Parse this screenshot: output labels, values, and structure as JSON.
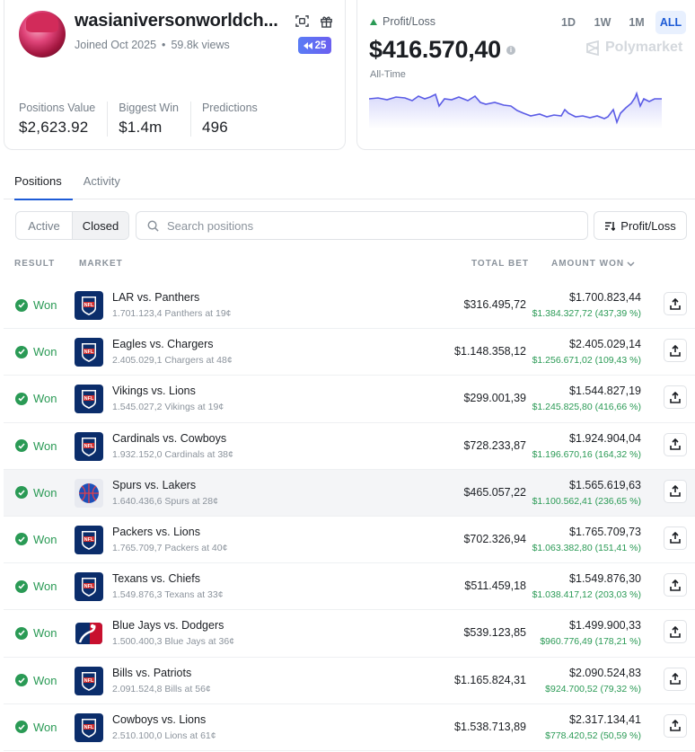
{
  "profile": {
    "username": "wasianiversonworldch...",
    "joined": "Joined Oct 2025",
    "views": "59.8k views",
    "level_badge": "25",
    "stats": [
      {
        "label": "Positions Value",
        "value": "$2,623.92"
      },
      {
        "label": "Biggest Win",
        "value": "$1.4m"
      },
      {
        "label": "Predictions",
        "value": "496"
      }
    ]
  },
  "pnl": {
    "label": "Profit/Loss",
    "value": "$416.570,40",
    "period_label": "All-Time",
    "ranges": [
      "1D",
      "1W",
      "1M",
      "ALL"
    ],
    "active_range": "ALL",
    "watermark": "Polymarket",
    "line_color": "#5b5ce6"
  },
  "tabs": [
    {
      "label": "Positions",
      "active": true
    },
    {
      "label": "Activity",
      "active": false
    }
  ],
  "filters": {
    "segment": [
      "Active",
      "Closed"
    ],
    "active_segment": "Closed",
    "search_placeholder": "Search positions",
    "sort_label": "Profit/Loss"
  },
  "table": {
    "headers": {
      "result": "RESULT",
      "market": "MARKET",
      "total_bet": "TOTAL BET",
      "amount_won": "AMOUNT WON"
    },
    "rows": [
      {
        "result": "Won",
        "league": "NFL",
        "title": "LAR vs. Panthers",
        "sub": "1.701.123,4 Panthers at 19¢",
        "bet": "$316.495,72",
        "won": "$1.700.823,44",
        "gain": "$1.384.327,72 (437,39 %)"
      },
      {
        "result": "Won",
        "league": "NFL",
        "title": "Eagles vs. Chargers",
        "sub": "2.405.029,1 Chargers at 48¢",
        "bet": "$1.148.358,12",
        "won": "$2.405.029,14",
        "gain": "$1.256.671,02 (109,43 %)"
      },
      {
        "result": "Won",
        "league": "NFL",
        "title": "Vikings vs. Lions",
        "sub": "1.545.027,2 Vikings at 19¢",
        "bet": "$299.001,39",
        "won": "$1.544.827,19",
        "gain": "$1.245.825,80 (416,66 %)"
      },
      {
        "result": "Won",
        "league": "NFL",
        "title": "Cardinals vs. Cowboys",
        "sub": "1.932.152,0 Cardinals at 38¢",
        "bet": "$728.233,87",
        "won": "$1.924.904,04",
        "gain": "$1.196.670,16 (164,32 %)"
      },
      {
        "result": "Won",
        "league": "NBA",
        "title": "Spurs vs. Lakers",
        "sub": "1.640.436,6 Spurs at 28¢",
        "bet": "$465.057,22",
        "won": "$1.565.619,63",
        "gain": "$1.100.562,41 (236,65 %)"
      },
      {
        "result": "Won",
        "league": "NFL",
        "title": "Packers vs. Lions",
        "sub": "1.765.709,7 Packers at 40¢",
        "bet": "$702.326,94",
        "won": "$1.765.709,73",
        "gain": "$1.063.382,80 (151,41 %)"
      },
      {
        "result": "Won",
        "league": "NFL",
        "title": "Texans vs. Chiefs",
        "sub": "1.549.876,3 Texans at 33¢",
        "bet": "$511.459,18",
        "won": "$1.549.876,30",
        "gain": "$1.038.417,12 (203,03 %)"
      },
      {
        "result": "Won",
        "league": "MLB",
        "title": "Blue Jays vs. Dodgers",
        "sub": "1.500.400,3 Blue Jays at 36¢",
        "bet": "$539.123,85",
        "won": "$1.499.900,33",
        "gain": "$960.776,49 (178,21 %)"
      },
      {
        "result": "Won",
        "league": "NFL",
        "title": "Bills vs. Patriots",
        "sub": "2.091.524,8 Bills at 56¢",
        "bet": "$1.165.824,31",
        "won": "$2.090.524,83",
        "gain": "$924.700,52 (79,32 %)"
      },
      {
        "result": "Won",
        "league": "NFL",
        "title": "Cowboys vs. Lions",
        "sub": "2.510.100,0 Lions at 61¢",
        "bet": "$1.538.713,89",
        "won": "$2.317.134,41",
        "gain": "$778.420,52 (50,59 %)"
      }
    ]
  }
}
